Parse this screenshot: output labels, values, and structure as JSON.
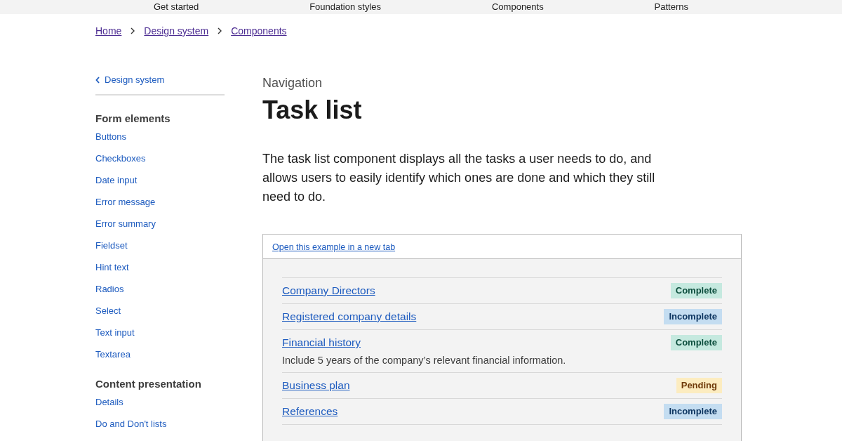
{
  "top_nav": [
    "Get started",
    "Foundation styles",
    "Components",
    "Patterns"
  ],
  "breadcrumbs": [
    "Home",
    "Design system",
    "Components"
  ],
  "sidebar": {
    "back_link": "Design system",
    "sections": [
      {
        "heading": "Form elements",
        "items": [
          "Buttons",
          "Checkboxes",
          "Date input",
          "Error message",
          "Error summary",
          "Fieldset",
          "Hint text",
          "Radios",
          "Select",
          "Text input",
          "Textarea"
        ]
      },
      {
        "heading": "Content presentation",
        "items": [
          "Details",
          "Do and Don't lists"
        ]
      }
    ]
  },
  "page": {
    "caption": "Navigation",
    "title": "Task list",
    "lead": "The task list component displays all the tasks a user needs to do, and allows users to easily identify which ones are done and which they still need to do."
  },
  "example": {
    "open_link": "Open this example in a new tab",
    "tasks": [
      {
        "name": "Company Directors",
        "status": "Complete",
        "kind": "complete"
      },
      {
        "name": "Registered company details",
        "status": "Incomplete",
        "kind": "incomplete"
      },
      {
        "name": "Financial history",
        "status": "Complete",
        "kind": "complete",
        "hint": "Include 5 years of the company’s relevant financial information."
      },
      {
        "name": "Business plan",
        "status": "Pending",
        "kind": "pending"
      },
      {
        "name": "References",
        "status": "Incomplete",
        "kind": "incomplete"
      }
    ]
  }
}
